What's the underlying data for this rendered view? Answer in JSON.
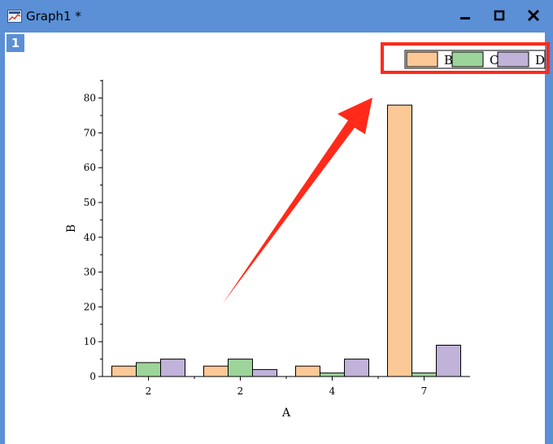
{
  "window": {
    "title": "Graph1 *",
    "layer_label": "1"
  },
  "colors": {
    "titlebar": "#5b8fd6",
    "highlight_box": "#ff2a1a",
    "arrow": "#ff2a1a"
  },
  "chart_data": {
    "type": "bar",
    "categories": [
      "2",
      "2",
      "4",
      "7"
    ],
    "xlabel": "A",
    "ylabel": "B",
    "ylim": [
      0,
      85
    ],
    "yticks": [
      0,
      10,
      20,
      30,
      40,
      50,
      60,
      70,
      80
    ],
    "grid": false,
    "legend_position": "top-right",
    "series": [
      {
        "name": "B",
        "color": "#fcc896",
        "values": [
          3,
          3,
          3,
          78
        ]
      },
      {
        "name": "C",
        "color": "#9dd49a",
        "values": [
          4,
          5,
          1,
          1
        ]
      },
      {
        "name": "D",
        "color": "#c0b2d8",
        "values": [
          5,
          2,
          5,
          9
        ]
      }
    ]
  }
}
